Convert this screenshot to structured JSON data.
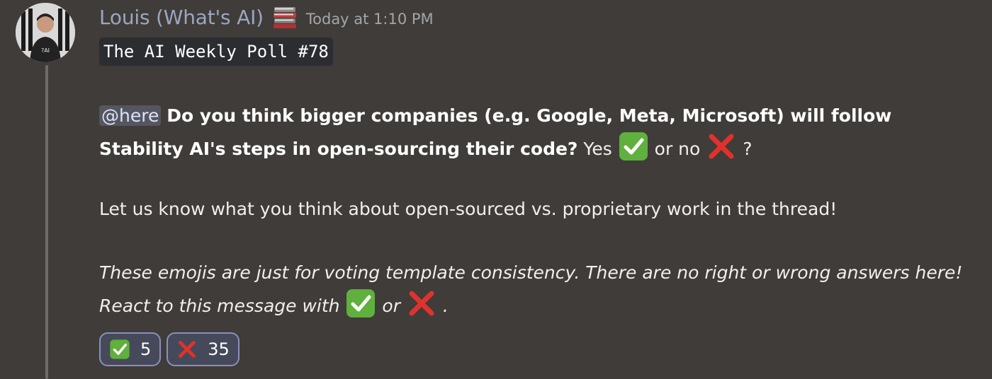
{
  "message": {
    "author": "Louis (What's AI)",
    "author_badge_icon": "books-icon",
    "timestamp": "Today at 1:10 PM",
    "title_code": "The AI Weekly Poll #78",
    "mention": "@here",
    "question_bold_line1": "Do you think bigger companies (e.g. Google, Meta, Microsoft) will follow",
    "question_bold_line2": "Stability AI's steps in open-sourcing their code?",
    "yes_text": "Yes",
    "or_no_text": "or no",
    "question_mark": "?",
    "thread_prompt": "Let us know what you think about open-sourced vs. proprietary work in the thread!",
    "note_line1": "These emojis are just for voting template consistency. There are no right or wrong answers here!",
    "note_line2_prefix": "React to this message with",
    "note_line2_or": "or",
    "note_line2_suffix": "."
  },
  "reactions": [
    {
      "emoji": "check-mark-icon",
      "count": "5"
    },
    {
      "emoji": "cross-mark-icon",
      "count": "35"
    }
  ],
  "colors": {
    "background": "#403c39",
    "author_name": "#9aa7c0",
    "mention_bg": "#54575f",
    "check_green": "#5fb03c",
    "cross_red": "#e0322c",
    "reaction_border": "#8a8fc0"
  }
}
